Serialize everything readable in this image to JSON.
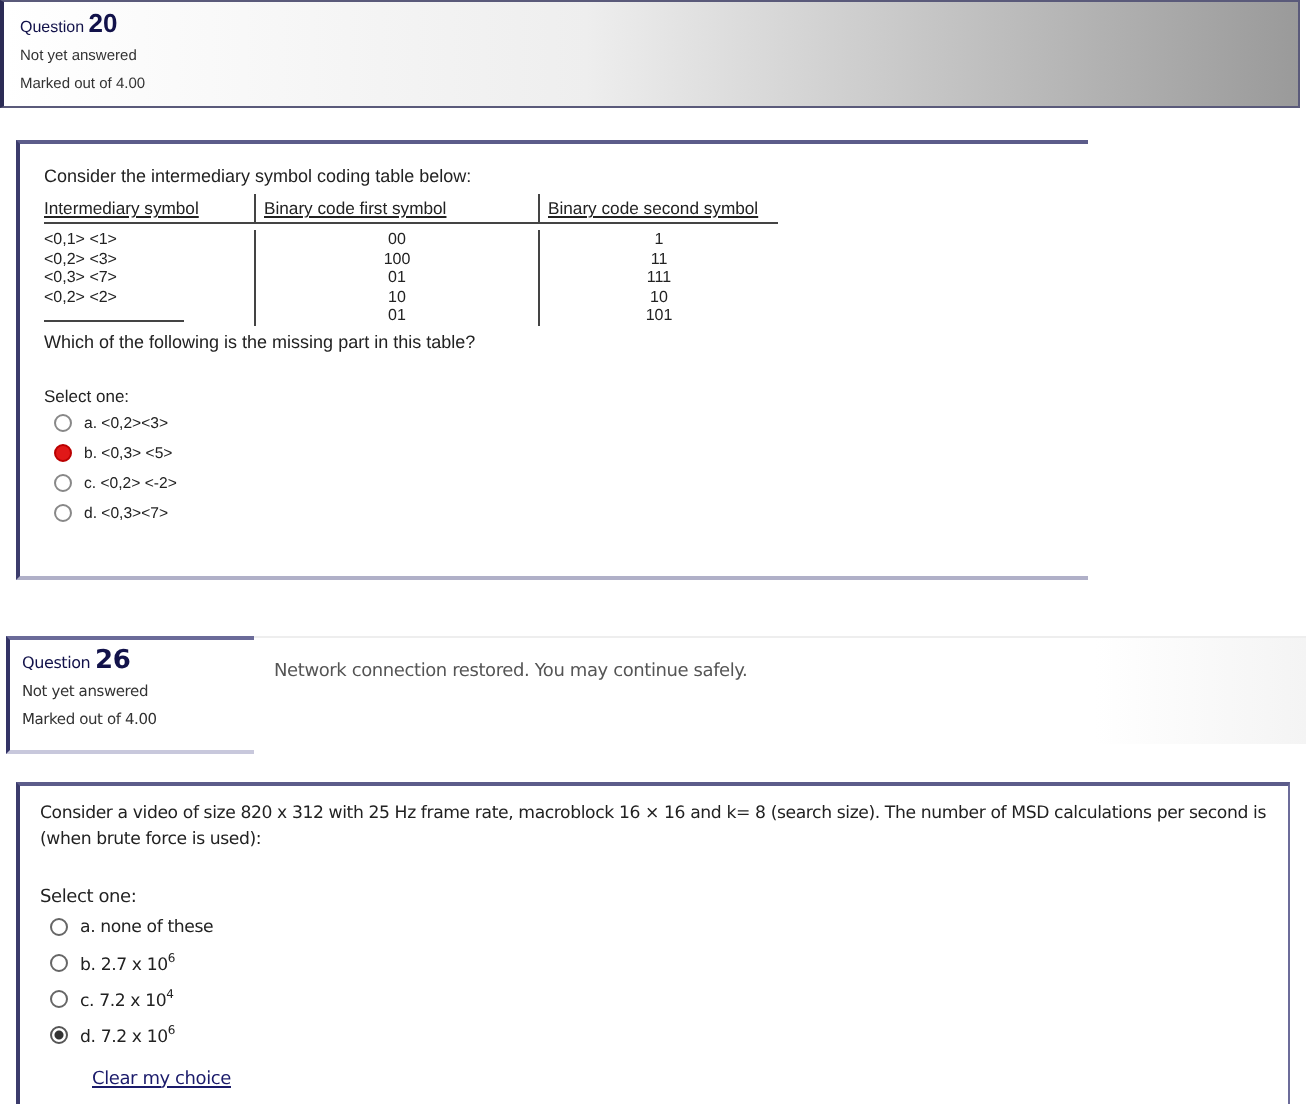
{
  "questions": [
    {
      "kind": "classic",
      "number": "20",
      "label": "Question",
      "status": "Not yet answered",
      "marks": "Marked out of 4.00",
      "intro": "Consider the intermediary symbol coding table below:",
      "table": {
        "columns": [
          "Intermediary symbol",
          "Binary code first symbol",
          "Binary code second symbol"
        ],
        "rows": [
          {
            "symbol": "<0,1> <1>",
            "first": "00",
            "second": "1"
          },
          {
            "symbol": "<0,2> <3>",
            "first": "100",
            "second": "11"
          },
          {
            "symbol": "<0,3> <7>",
            "first": "01",
            "second": "111"
          },
          {
            "symbol": "<0,2> <2>",
            "first": "10",
            "second": "10"
          },
          {
            "first": "01",
            "second": "101"
          }
        ]
      },
      "prompt": "Which of the following is the missing part in this table?",
      "select_label": "Select one:",
      "options": [
        {
          "label": "a. <0,2><3>",
          "selected": false
        },
        {
          "label": "b. <0,3> <5>",
          "selected": true
        },
        {
          "label": "c. <0,2> <-2>",
          "selected": false
        },
        {
          "label": "d. <0,3><7>",
          "selected": false
        }
      ]
    },
    {
      "kind": "modern",
      "number": "26",
      "label": "Question",
      "status": "Not yet answered",
      "marks": "Marked out of 4.00",
      "notice": "Network connection restored. You may continue safely.",
      "prompt": "Consider a video of size 820 x 312 with 25 Hz frame rate, macroblock 16 × 16 and k= 8  (search size). The number of MSD calculations per second is (when brute force is used):",
      "select_label": "Select one:",
      "options": [
        {
          "label": "a. none of these",
          "selected": false
        },
        {
          "label": "b. 2.7 x 10$^{6}$",
          "selected": false
        },
        {
          "label": "c. 7.2 x 10$^{4}$",
          "selected": false
        },
        {
          "label": "d. 7.2 x 10$^{6}$",
          "selected": true
        }
      ],
      "clear_link": "Clear my choice"
    }
  ]
}
